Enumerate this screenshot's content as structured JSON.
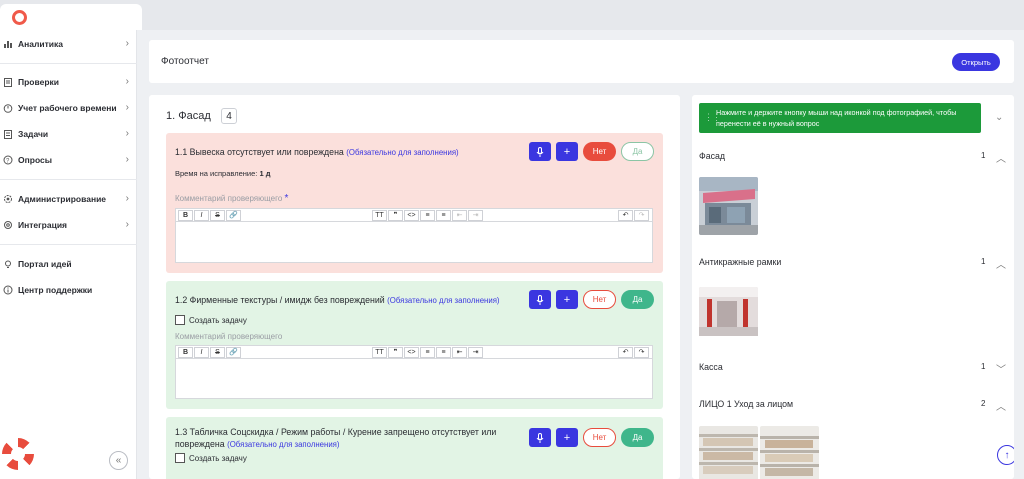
{
  "sidebar": {
    "items": [
      {
        "label": "Аналитика",
        "icon": "bar-chart-icon",
        "chevron": true
      },
      {
        "label": "Проверки",
        "icon": "clipboard-icon",
        "chevron": true
      },
      {
        "label": "Учет рабочего времени",
        "icon": "stopwatch-icon",
        "chevron": true
      },
      {
        "label": "Задачи",
        "icon": "tasks-icon",
        "chevron": true
      },
      {
        "label": "Опросы",
        "icon": "question-icon",
        "chevron": true
      },
      {
        "label": "Администрирование",
        "icon": "admin-gear-icon",
        "chevron": true
      },
      {
        "label": "Интеграция",
        "icon": "integration-icon",
        "chevron": true
      },
      {
        "label": "Портал идей",
        "icon": "lightbulb-icon",
        "chevron": false
      },
      {
        "label": "Центр поддержки",
        "icon": "info-icon",
        "chevron": false
      }
    ]
  },
  "header": {
    "title": "Фотоотчет",
    "open_label": "Открыть"
  },
  "section": {
    "title": "1. Фасад",
    "count": "4"
  },
  "questions": [
    {
      "title": "1.1 Вывеска отсутствует или повреждена",
      "required": "(Обязательно для заполнения)",
      "fix_label": "Время на исправление:",
      "fix_value": "1 д",
      "comment_label": "Комментарий проверяющего",
      "no": "Нет",
      "yes": "Да",
      "answer": "Нет"
    },
    {
      "title": "1.2 Фирменные текстуры / имидж без повреждений",
      "required": "(Обязательно для заполнения)",
      "task_label": "Создать задачу",
      "comment_label": "Комментарий проверяющего",
      "no": "Нет",
      "yes": "Да",
      "answer": "Да"
    },
    {
      "title": "1.3 Табличка Соцскидка / Режим работы / Курение запрещено отсутствует или повреждена",
      "required": "(Обязательно для заполнения)",
      "task_label": "Создать задачу",
      "no": "Нет",
      "yes": "Да",
      "answer": "Да"
    }
  ],
  "toolbar_icons": {
    "bold": "B",
    "italic": "I",
    "strike": "S",
    "link": "🔗",
    "heading": "TT",
    "quote": "❞",
    "code": "<>",
    "bullet": "≡",
    "numbered": "≡",
    "outdent": "⇤",
    "indent": "⇥",
    "undo": "↶",
    "redo": "↷"
  },
  "right_panel": {
    "hint": "Нажмите и держите кнопку мыши над иконкой под фотографией, чтобы перенести её в нужный вопрос",
    "groups": [
      {
        "name": "Фасад",
        "count": "1",
        "expanded": true
      },
      {
        "name": "Антикражные рамки",
        "count": "1",
        "expanded": true
      },
      {
        "name": "Касса",
        "count": "1",
        "expanded": false
      },
      {
        "name": "ЛИЦО 1 Уход за лицом",
        "count": "2",
        "expanded": true
      }
    ]
  },
  "colors": {
    "accent": "#3a36e0",
    "danger": "#e84c3d",
    "success": "#3fb68b",
    "hint_bg": "#1c9a3a"
  }
}
